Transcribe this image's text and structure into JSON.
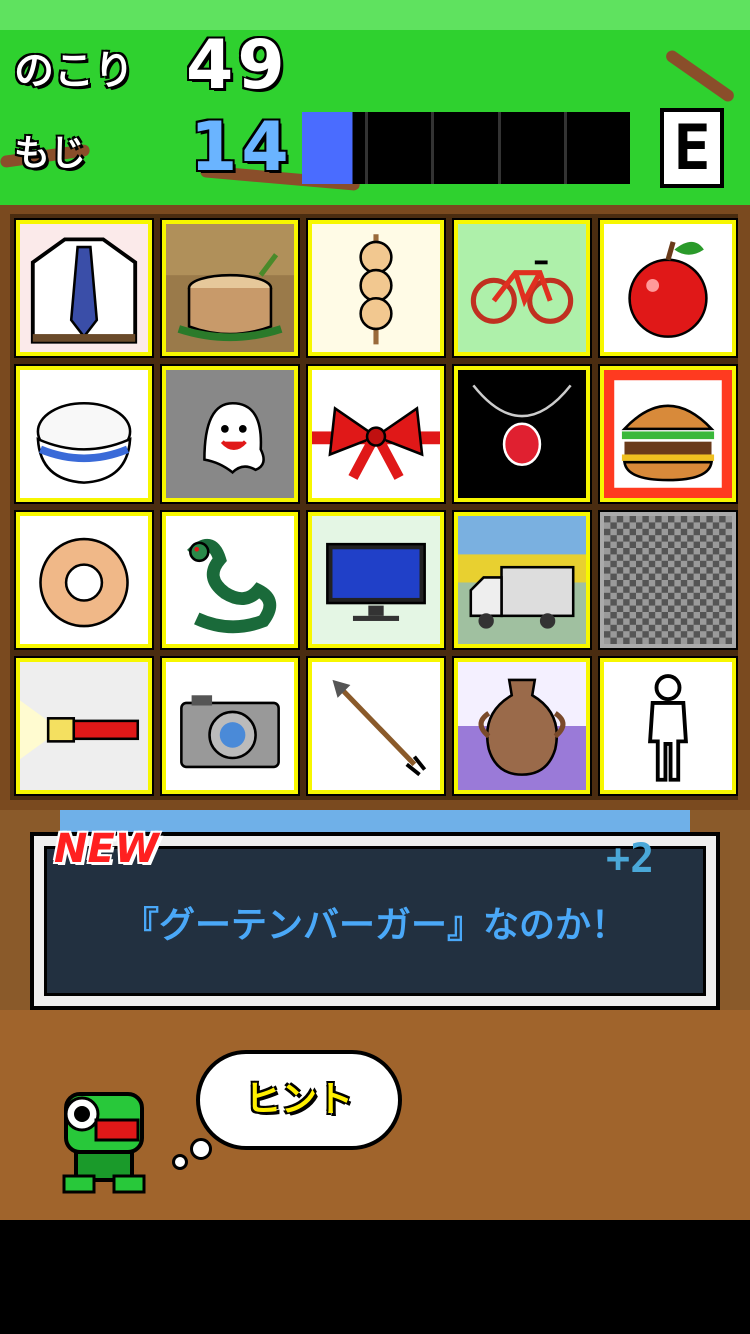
{
  "header": {
    "remaining_label": "のこり",
    "remaining_value": "49",
    "chars_label": "もじ",
    "chars_value": "14",
    "rank": "E",
    "meter_filled_fraction": 0.16,
    "colors": {
      "grass": "#2fd12f",
      "meter_fill": "#4a6cff"
    }
  },
  "grid": {
    "tiles": [
      {
        "icon": "shirt-tie-icon",
        "bg": "#fbeaea"
      },
      {
        "icon": "tree-stump-icon",
        "bg": "#9a7a4a"
      },
      {
        "icon": "dango-skewer-icon",
        "bg": "#fffbe6"
      },
      {
        "icon": "bicycle-icon",
        "bg": "#aef0aa"
      },
      {
        "icon": "apple-icon",
        "bg": "#ffffff"
      },
      {
        "icon": "rice-bowl-icon",
        "bg": "#ffffff"
      },
      {
        "icon": "ghost-icon",
        "bg": "#888888"
      },
      {
        "icon": "red-ribbon-icon",
        "bg": "#ffffff"
      },
      {
        "icon": "pendant-necklace-icon",
        "bg": "#000000"
      },
      {
        "icon": "hamburger-icon",
        "bg": "#ff3a20"
      },
      {
        "icon": "donut-icon",
        "bg": "#ffffff"
      },
      {
        "icon": "snake-icon",
        "bg": "#ffffff"
      },
      {
        "icon": "monitor-icon",
        "bg": "#e4f6e4"
      },
      {
        "icon": "truck-icon",
        "bg": "#a0c0a0"
      },
      {
        "icon": "checkered-blank-icon",
        "bg": "#888888"
      },
      {
        "icon": "flashlight-icon",
        "bg": "#eeeeee"
      },
      {
        "icon": "camera-icon",
        "bg": "#ffffff"
      },
      {
        "icon": "arrow-icon",
        "bg": "#ffffff"
      },
      {
        "icon": "clay-pot-icon",
        "bg": "#9a7ad8"
      },
      {
        "icon": "person-outline-icon",
        "bg": "#ffffff"
      }
    ]
  },
  "message": {
    "new_label": "NEW",
    "plus_label": "+2",
    "text": "『グーテンバーガー』なのか！"
  },
  "hint": {
    "label": "ヒント"
  }
}
